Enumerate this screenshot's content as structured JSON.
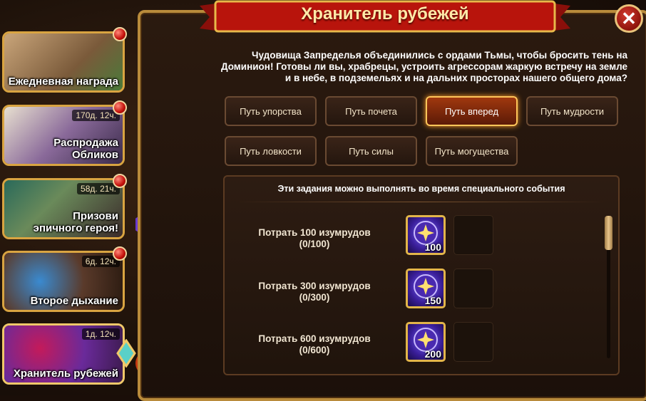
{
  "sidebar": {
    "items": [
      {
        "label": "Ежедневная награда",
        "timer": ""
      },
      {
        "label": "Распродажа Обликов",
        "timer": "170д. 12ч."
      },
      {
        "label": "Призови эпичного героя!",
        "timer": "58д. 21ч."
      },
      {
        "label": "Второе дыхание",
        "timer": "6д. 12ч."
      },
      {
        "label": "Хранитель рубежей",
        "timer": "1д. 12ч."
      }
    ]
  },
  "header": {
    "title": "Хранитель рубежей",
    "close_icon": "close-icon"
  },
  "description": "Чудовища Запределья объединились с ордами Тьмы, чтобы бросить тень на Доминион! Готовы ли вы, храбрецы, устроить агрессорам жаркую встречу на земле и в небе, в подземельях и на дальних просторах нашего общего дома?",
  "paths": [
    {
      "label": "Путь упорства"
    },
    {
      "label": "Путь почета"
    },
    {
      "label": "Путь вперед",
      "active": true
    },
    {
      "label": "Путь мудрости"
    },
    {
      "label": "Путь ловкости"
    },
    {
      "label": "Путь силы"
    },
    {
      "label": "Путь могущества"
    }
  ],
  "tasks": {
    "header": "Эти задания можно выполнять во время специального события",
    "items": [
      {
        "title": "Потрать 100 изумрудов",
        "progress": "(0/100)",
        "reward": "100",
        "reward_icon": "star-coin-icon"
      },
      {
        "title": "Потрать 300 изумрудов",
        "progress": "(0/300)",
        "reward": "150",
        "reward_icon": "star-coin-icon"
      },
      {
        "title": "Потрать 600 изумрудов",
        "progress": "(0/600)",
        "reward": "200",
        "reward_icon": "star-coin-icon"
      }
    ]
  },
  "colors": {
    "accent": "#ffc65a",
    "frame": "#b98b3b",
    "badge": "#c4100b"
  }
}
